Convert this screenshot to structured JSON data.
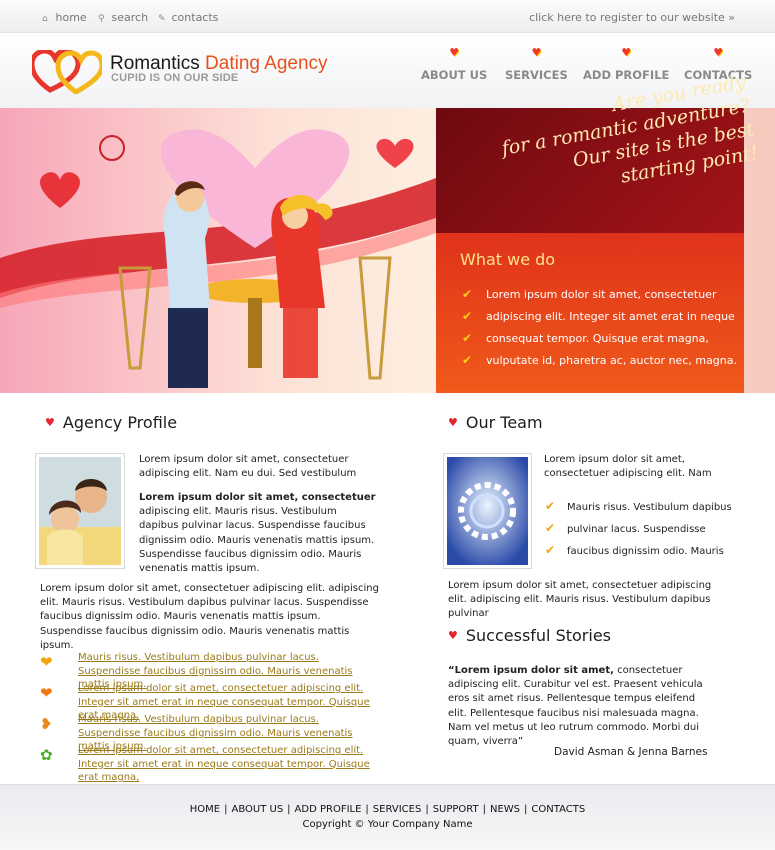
{
  "topbar": {
    "links": [
      {
        "icon": "home-icon",
        "glyph": "⌂",
        "label": "home"
      },
      {
        "icon": "search-icon",
        "glyph": "⚲",
        "label": "search"
      },
      {
        "icon": "pencil-icon",
        "glyph": "✎",
        "label": "contacts"
      }
    ],
    "register": "click here to register to our website  »"
  },
  "header": {
    "brand_first": "Romantics",
    "brand_second": "Dating Agency",
    "slogan": "CUPID IS ON OUR SIDE",
    "nav": [
      "ABOUT US",
      "SERVICES",
      "ADD PROFILE",
      "CONTACTS"
    ]
  },
  "banner": {
    "tagline_1": "Are you ready",
    "tagline_2": "for a romantic adventure?",
    "tagline_3": "Our site is the best",
    "tagline_4": "starting point!",
    "what_we_do_title": "What we do",
    "what_we_do": [
      "Lorem ipsum dolor sit amet, consectetuer",
      "adipiscing elit. Integer sit amet erat in neque",
      "consequat tempor. Quisque erat magna,",
      "vulputate id, pharetra ac, auctor nec, magna."
    ]
  },
  "agency": {
    "title": "Agency Profile",
    "intro": "Lorem ipsum dolor sit amet, consectetuer adipiscing elit. Nam eu dui. Sed vestibulum",
    "bold_lead": "Lorem ipsum dolor sit amet, consectetuer",
    "body": "adipiscing elit. Mauris risus. Vestibulum dapibus pulvinar lacus. Suspendisse faucibus dignissim odio. Mauris venenatis mattis ipsum.  Suspendisse faucibus dignissim odio. Mauris venenatis mattis ipsum.",
    "full": "Lorem ipsum dolor sit amet, consectetuer adipiscing elit. adipiscing elit. Mauris risus. Vestibulum dapibus pulvinar lacus. Suspendisse faucibus dignissim odio. Mauris venenatis mattis ipsum.  Suspendisse faucibus dignissim odio. Mauris venenatis mattis ipsum.",
    "links": [
      {
        "icon": "hearts-icon",
        "glyph": "❤",
        "color": "#f2a40c",
        "text": "Mauris risus. Vestibulum dapibus pulvinar lacus. Suspendisse faucibus dignissim odio. Mauris venenatis mattis ipsum."
      },
      {
        "icon": "broken-heart-icon",
        "glyph": "❤",
        "color": "#f07a0c",
        "text": "Lorem ipsum dolor sit amet, consectetuer adipiscing elit. Integer sit amet erat in neque consequat tempor. Quisque erat magna,"
      },
      {
        "icon": "heart-arrow-icon",
        "glyph": "❥",
        "color": "#e8881a",
        "text": "Mauris risus. Vestibulum dapibus pulvinar lacus. Suspendisse faucibus dignissim odio. Mauris venenatis mattis ipsum."
      },
      {
        "icon": "clover-icon",
        "glyph": "✿",
        "color": "#4caf2a",
        "text": "Lorem ipsum dolor sit amet, consectetuer adipiscing elit. Integer sit amet erat in neque consequat tempor. Quisque erat magna,"
      }
    ]
  },
  "team": {
    "title": "Our Team",
    "intro": "Lorem ipsum dolor sit amet, consectetuer adipiscing elit. Nam",
    "list": [
      "Mauris risus. Vestibulum dapibus",
      "pulvinar lacus. Suspendisse",
      "faucibus dignissim odio. Mauris"
    ],
    "body": "Lorem ipsum dolor sit amet, consectetuer adipiscing elit. adipiscing elit. Mauris risus. Vestibulum dapibus pulvinar"
  },
  "stories": {
    "title": "Successful Stories",
    "quote_lead": "“Lorem ipsum dolor sit amet,",
    "quote_body": " consectetuer adipiscing elit. Curabitur vel est. Praesent vehicula eros sit amet risus. Pellentesque tempus eleifend elit. Pellentesque faucibus nisi malesuada magna. Nam vel metus ut leo rutrum commodo. Morbi dui quam, viverra”",
    "author": "David Asman & Jenna Barnes"
  },
  "footer": {
    "nav": [
      "HOME",
      "ABOUT US",
      "ADD PROFILE",
      "SERVICES",
      "SUPPORT",
      "NEWS",
      "CONTACTS"
    ],
    "copyright": "Copyright © Your Company Name"
  }
}
